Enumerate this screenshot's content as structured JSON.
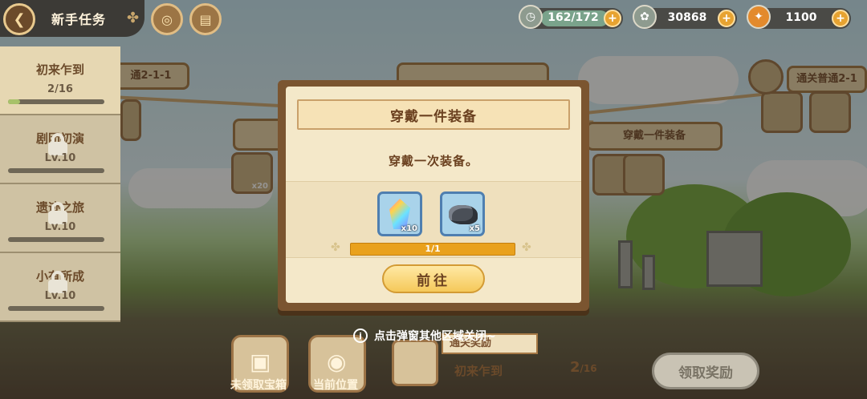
{
  "header": {
    "back_icon": "heart-back-icon",
    "title": "新手任务",
    "clover_icon": "clover-icon",
    "icons": [
      "compass-icon",
      "book-icon"
    ]
  },
  "resources": [
    {
      "name": "energy",
      "icon": "clock-icon",
      "value": "162/172"
    },
    {
      "name": "coins",
      "icon": "coin-icon",
      "value": "30868"
    },
    {
      "name": "carrots",
      "icon": "carrot-icon",
      "value": "1100"
    }
  ],
  "tasks": [
    {
      "name": "初来乍到",
      "progress": "2/16",
      "locked": false,
      "progress_fraction": 0.125
    },
    {
      "name": "剧团初演",
      "progress": "Lv.10",
      "locked": true
    },
    {
      "name": "遗迹之旅",
      "progress": "Lv.10",
      "locked": true
    },
    {
      "name": "小有所成",
      "progress": "Lv.10",
      "locked": true
    }
  ],
  "modal": {
    "title": "穿戴一件装备",
    "description": "穿戴一次装备。",
    "items": [
      {
        "name": "rainbow-crystal",
        "count": "x10"
      },
      {
        "name": "ore-stone",
        "count": "x5"
      }
    ],
    "progress": "1/1",
    "progress_fraction": 1.0,
    "go_label": "前往"
  },
  "hint": "点击弹窗其他区域关闭~",
  "bottom": {
    "chest_label": "未领取宝箱",
    "location_label": "当前位置",
    "reward_tag": "通关奖励",
    "reward_name": "初来乍到",
    "reward_count": "2",
    "reward_total": "/16",
    "claim_label": "领取奖励"
  },
  "background_cards": {
    "left_label": "通2-1-1",
    "mid_label": "穿戴一件装备",
    "right_label": "通关普通2-1",
    "small_count": "x20"
  },
  "colors": {
    "modal_frame": "#7b5530",
    "modal_paper": "#f4e8c9",
    "progress": "#e9a11d",
    "go_button": "#f5c95a",
    "claim_disabled": "#c9c3b4"
  }
}
